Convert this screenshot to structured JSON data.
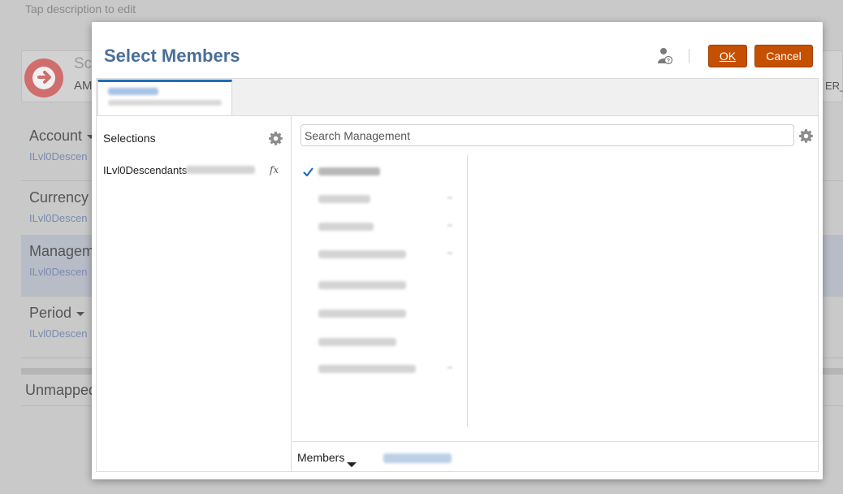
{
  "background": {
    "description_hint": "Tap description to edit",
    "header_title_partial": "Sc",
    "header_subtitle_partial": "AM",
    "header_right_partial": "ER_",
    "dimensions": [
      {
        "name": "Account",
        "has_dropdown": true,
        "selection": "ILvl0Descen"
      },
      {
        "name": "Currency",
        "has_dropdown": false,
        "selection": "ILvl0Descen"
      },
      {
        "name": "Managem",
        "has_dropdown": false,
        "selection": "ILvl0Descen"
      },
      {
        "name": "Period",
        "has_dropdown": true,
        "selection": "ILvl0Descen"
      }
    ],
    "unmapped_label": "Unmapped"
  },
  "dialog": {
    "title": "Select Members",
    "ok_label": "OK",
    "cancel_label": "Cancel",
    "selections_title": "Selections",
    "selection_item": "ILvl0Descendants",
    "fx_label": "fx",
    "search_placeholder": "Search Management",
    "members_label": "Members",
    "tree_item_count": 8,
    "tree_checked_index": 0,
    "icons": [
      "help-user-icon",
      "gear-icon",
      "fx-icon",
      "checkmark-icon",
      "chevron-down-icon"
    ]
  },
  "colors": {
    "accent_button": "#c45000",
    "title_blue": "#4a6f96",
    "tab_active_border": "#1d6fb8"
  }
}
